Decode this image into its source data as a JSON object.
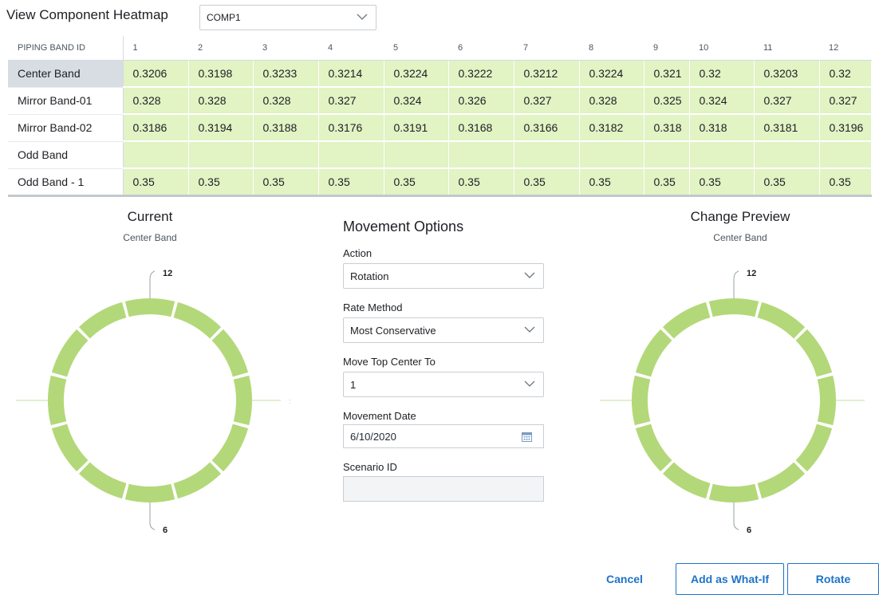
{
  "header": {
    "title": "View Component Heatmap",
    "component_value": "COMP1"
  },
  "table": {
    "id_header": "PIPING BAND ID",
    "columns": [
      "1",
      "2",
      "3",
      "4",
      "5",
      "6",
      "7",
      "8",
      "9",
      "10",
      "11",
      "12"
    ],
    "rows": [
      {
        "name": "Center Band",
        "values": [
          "0.3206",
          "0.3198",
          "0.3233",
          "0.3214",
          "0.3224",
          "0.3222",
          "0.3212",
          "0.3224",
          "0.321",
          "0.32",
          "0.3203",
          "0.32"
        ]
      },
      {
        "name": "Mirror Band-01",
        "values": [
          "0.328",
          "0.328",
          "0.328",
          "0.327",
          "0.324",
          "0.326",
          "0.327",
          "0.328",
          "0.325",
          "0.324",
          "0.327",
          "0.327"
        ]
      },
      {
        "name": "Mirror Band-02",
        "values": [
          "0.3186",
          "0.3194",
          "0.3188",
          "0.3176",
          "0.3191",
          "0.3168",
          "0.3166",
          "0.3182",
          "0.318",
          "0.318",
          "0.3181",
          "0.3196"
        ]
      },
      {
        "name": "Odd Band",
        "values": [
          "",
          "",
          "",
          "",
          "",
          "",
          "",
          "",
          "",
          "",
          "",
          ""
        ]
      },
      {
        "name": "Odd Band - 1",
        "values": [
          "0.35",
          "0.35",
          "0.35",
          "0.35",
          "0.35",
          "0.35",
          "0.35",
          "0.35",
          "0.35",
          "0.35",
          "0.35",
          "0.35"
        ]
      }
    ],
    "selected_row": "Center Band",
    "cell_color": "#e2f3c4"
  },
  "current": {
    "title": "Current",
    "band": "Center Band",
    "top_label": "12",
    "bottom_label": "6"
  },
  "preview": {
    "title": "Change Preview",
    "band": "Center Band",
    "top_label": "12",
    "bottom_label": "6"
  },
  "ring_color": "#b3d879",
  "movement": {
    "title": "Movement Options",
    "action_label": "Action",
    "action_value": "Rotation",
    "rate_label": "Rate Method",
    "rate_value": "Most Conservative",
    "move_label": "Move Top Center To",
    "move_value": "1",
    "date_label": "Movement Date",
    "date_value": "6/10/2020",
    "scenario_label": "Scenario ID",
    "scenario_value": ""
  },
  "buttons": {
    "cancel": "Cancel",
    "what_if": "Add as What-If",
    "rotate": "Rotate"
  },
  "accent_color": "#1e73c8"
}
